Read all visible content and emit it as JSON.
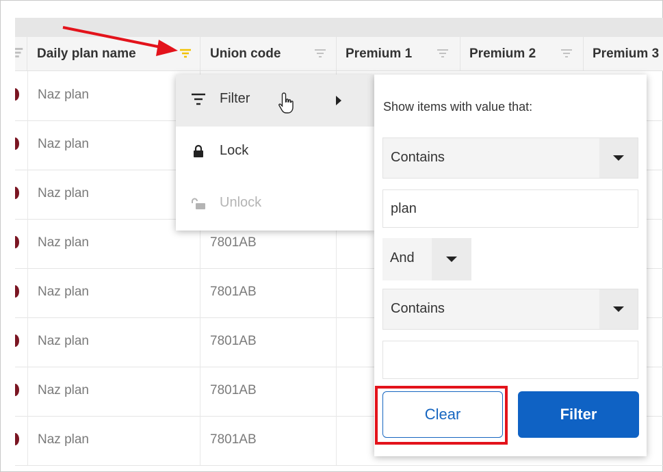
{
  "grid": {
    "columns": [
      {
        "label": "Daily plan name",
        "filter_icon": "filter-icon",
        "filter_active": true
      },
      {
        "label": "Union code",
        "filter_icon": "filter-icon",
        "filter_active": false
      },
      {
        "label": "Premium 1",
        "filter_icon": "filter-icon",
        "filter_active": false
      },
      {
        "label": "Premium 2",
        "filter_icon": "filter-icon",
        "filter_active": false
      },
      {
        "label": "Premium 3",
        "filter_icon": "filter-icon",
        "filter_active": false
      }
    ],
    "rows": [
      {
        "name": "Naz plan",
        "code": ""
      },
      {
        "name": "Naz plan",
        "code": ""
      },
      {
        "name": "Naz plan",
        "code": ""
      },
      {
        "name": "Naz plan",
        "code": "7801AB"
      },
      {
        "name": "Naz plan",
        "code": "7801AB"
      },
      {
        "name": "Naz plan",
        "code": "7801AB"
      },
      {
        "name": "Naz plan",
        "code": "7801AB"
      },
      {
        "name": "Naz plan",
        "code": "7801AB"
      }
    ]
  },
  "column_menu": {
    "items": [
      {
        "label": "Filter",
        "icon": "filter-icon",
        "active": true,
        "submenu": true
      },
      {
        "label": "Lock",
        "icon": "lock-icon",
        "active": false
      },
      {
        "label": "Unlock",
        "icon": "unlock-icon",
        "disabled": true
      }
    ]
  },
  "filter_panel": {
    "title": "Show items with value that:",
    "operator1": "Contains",
    "value1": "plan",
    "logic": "And",
    "operator2": "Contains",
    "value2": "",
    "clear_label": "Clear",
    "filter_label": "Filter"
  },
  "colors": {
    "active_filter": "#f2c200",
    "primary": "#0f62c4",
    "annotation": "#e3131b",
    "row_indicator": "#7a1522"
  }
}
